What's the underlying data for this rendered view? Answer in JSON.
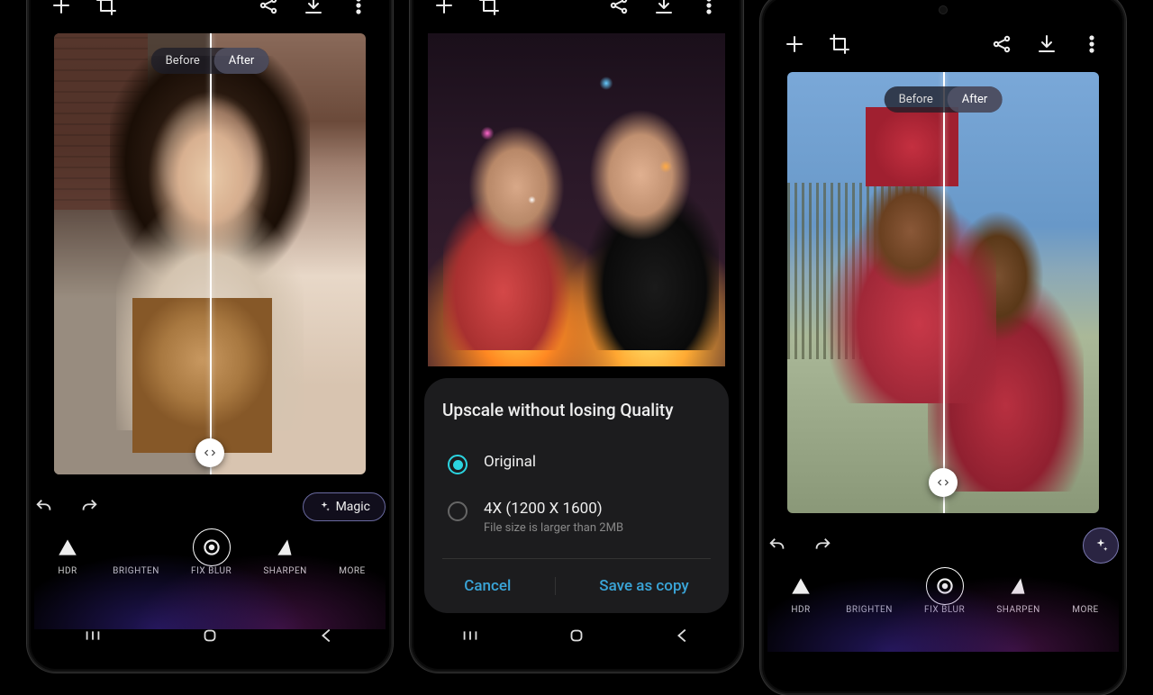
{
  "toolbar": {
    "add": "+",
    "crop": "crop",
    "share": "share",
    "download": "download",
    "more": "more"
  },
  "compare": {
    "before": "Before",
    "after": "After"
  },
  "magic_label": "Magic",
  "effects": {
    "hdr": "HDR",
    "brighten": "BRIGHTEN",
    "fixblur": "FIX BLUR",
    "sharpen": "SHARPEN",
    "more": "MORE"
  },
  "sheet": {
    "title": "Upscale without losing Quality",
    "opt1": "Original",
    "opt2": "4X (1200 X 1600)",
    "opt2_sub": "File size is larger than 2MB",
    "cancel": "Cancel",
    "save": "Save as copy"
  }
}
